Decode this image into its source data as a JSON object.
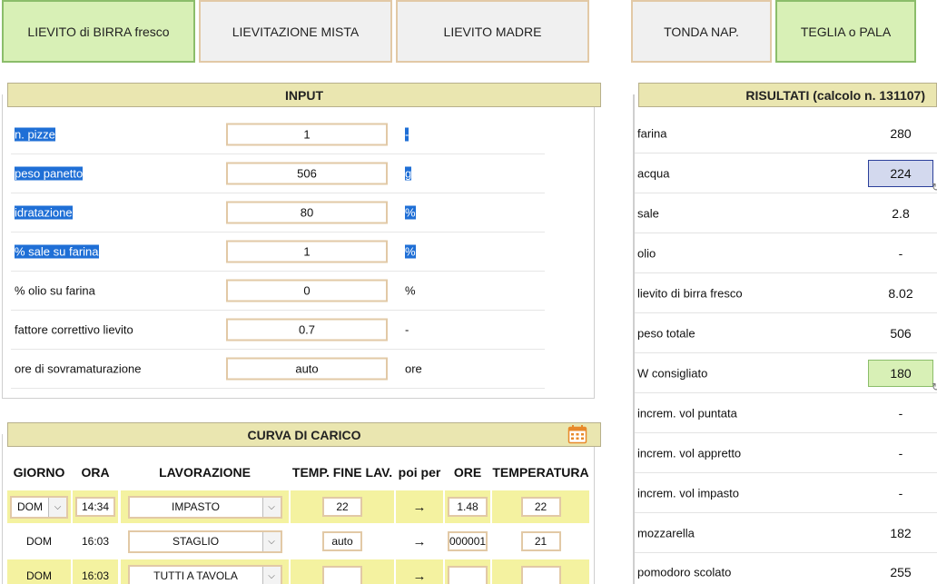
{
  "tabs": [
    {
      "label": "LIEVITO di BIRRA fresco",
      "active": true
    },
    {
      "label": "LIEVITAZIONE MISTA",
      "active": false
    },
    {
      "label": "LIEVITO MADRE",
      "active": false
    },
    {
      "label": "TONDA NAP.",
      "active": false
    },
    {
      "label": "TEGLIA o PALA",
      "active": true
    }
  ],
  "input": {
    "title": "INPUT",
    "rows": [
      {
        "label": "n. pizze",
        "value": "1",
        "unit": "-"
      },
      {
        "label": "peso panetto",
        "value": "506",
        "unit": "g"
      },
      {
        "label": "idratazione",
        "value": "80",
        "unit": "%"
      },
      {
        "label": "% sale su farina",
        "value": "1",
        "unit": "%"
      },
      {
        "label": "% olio su farina",
        "value": "0",
        "unit": "%"
      },
      {
        "label": "fattore correttivo lievito",
        "value": "0.7",
        "unit": "-"
      },
      {
        "label": "ore di sovramaturazione",
        "value": "auto",
        "unit": "ore"
      }
    ]
  },
  "results": {
    "title": "RISULTATI (calcolo n. 131107)",
    "rows": [
      {
        "label": "farina",
        "value": "280"
      },
      {
        "label": "acqua",
        "value": "224"
      },
      {
        "label": "sale",
        "value": "2.8"
      },
      {
        "label": "olio",
        "value": "-"
      },
      {
        "label": "lievito di birra fresco",
        "value": "8.02"
      },
      {
        "label": "peso totale",
        "value": "506"
      },
      {
        "label": "W consigliato",
        "value": "180"
      },
      {
        "label": "increm. vol puntata",
        "value": "-"
      },
      {
        "label": "increm. vol appretto",
        "value": "-"
      },
      {
        "label": "increm. vol impasto",
        "value": "-"
      },
      {
        "label": "mozzarella",
        "value": "182"
      },
      {
        "label": "pomodoro scolato",
        "value": "255"
      }
    ]
  },
  "curve": {
    "title": "CURVA DI CARICO",
    "headers": [
      "GIORNO",
      "ORA",
      "LAVORAZIONE",
      "TEMP. FINE LAV.",
      "poi per",
      "ORE",
      "TEMPERATURA"
    ],
    "rows": [
      {
        "day": "DOM",
        "time": "14:34",
        "step": "IMPASTO",
        "temp_end": "22",
        "arrow": "→",
        "hours": "1.48",
        "temperature": "22"
      },
      {
        "day": "DOM",
        "time": "16:03",
        "step": "STAGLIO",
        "temp_end": "auto",
        "arrow": "→",
        "hours": "000001",
        "temperature": "21"
      },
      {
        "day": "DOM",
        "time": "16:03",
        "step": "TUTTI A TAVOLA",
        "temp_end": "",
        "arrow": "→",
        "hours": "",
        "temperature": ""
      }
    ]
  },
  "icons": {
    "dropdown": "chevron-down-icon",
    "calendar": "calendar-icon"
  },
  "colors": {
    "active_tab": "#d8f0b6",
    "section_header": "#eae6b0",
    "selection": "#1f6fd6",
    "row_yellow": "#f4f2a0"
  }
}
